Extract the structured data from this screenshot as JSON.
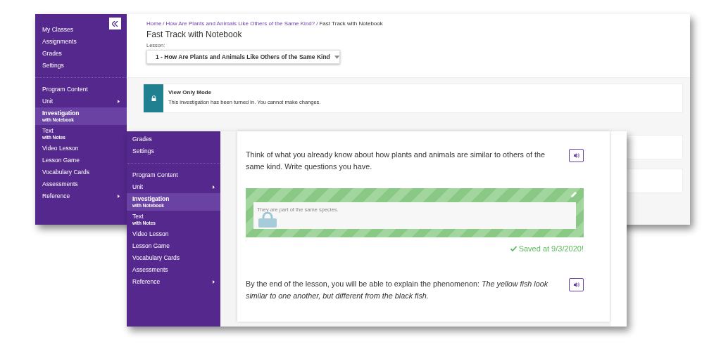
{
  "back_window": {
    "sidebar": {
      "account_items": [
        {
          "label": "My Classes",
          "selected": false,
          "submenu": false
        },
        {
          "label": "Assignments",
          "selected": false,
          "submenu": false
        },
        {
          "label": "Grades",
          "selected": false,
          "submenu": false
        },
        {
          "label": "Settings",
          "selected": false,
          "submenu": false
        }
      ],
      "content_items": [
        {
          "label": "Program Content",
          "selected": false,
          "submenu": false
        },
        {
          "label": "Unit",
          "selected": false,
          "submenu": true
        },
        {
          "label": "Investigation",
          "sublabel": "with Notebook",
          "selected": true,
          "submenu": false
        },
        {
          "label": "Text",
          "sublabel": "with Notes",
          "selected": false,
          "submenu": false
        },
        {
          "label": "Video Lesson",
          "selected": false,
          "submenu": false
        },
        {
          "label": "Lesson Game",
          "selected": false,
          "submenu": false
        },
        {
          "label": "Vocabulary Cards",
          "selected": false,
          "submenu": false
        },
        {
          "label": "Assessments",
          "selected": false,
          "submenu": false
        },
        {
          "label": "Reference",
          "selected": false,
          "submenu": true
        }
      ]
    },
    "breadcrumb": {
      "separator": "/",
      "items": [
        "Home",
        "How Are Plants and Animals Like Others of the Same Kind?",
        "Fast Track with Notebook"
      ]
    },
    "title": "Fast Track with Notebook",
    "lesson_label": "Lesson:",
    "lesson_select": "1 - How Are Plants and Animals Like Others of the Same Kind",
    "notice": {
      "title": "View Only Mode",
      "message": "This investigation has been turned in. You cannot make changes."
    }
  },
  "front_window": {
    "sidebar": {
      "account_items": [
        {
          "label": "Grades",
          "selected": false,
          "submenu": false
        },
        {
          "label": "Settings",
          "selected": false,
          "submenu": false
        }
      ],
      "content_items": [
        {
          "label": "Program Content",
          "selected": false,
          "submenu": false
        },
        {
          "label": "Unit",
          "selected": false,
          "submenu": true
        },
        {
          "label": "Investigation",
          "sublabel": "with Notebook",
          "selected": true,
          "submenu": false
        },
        {
          "label": "Text",
          "sublabel": "with Notes",
          "selected": false,
          "submenu": false
        },
        {
          "label": "Video Lesson",
          "selected": false,
          "submenu": false
        },
        {
          "label": "Lesson Game",
          "selected": false,
          "submenu": false
        },
        {
          "label": "Vocabulary Cards",
          "selected": false,
          "submenu": false
        },
        {
          "label": "Assessments",
          "selected": false,
          "submenu": false
        },
        {
          "label": "Reference",
          "selected": false,
          "submenu": true
        }
      ]
    },
    "prompt": "Think of what you already know about how plants and animals are similar to others of the same kind. Write questions you have.",
    "answer": {
      "value": "They are part of the same species."
    },
    "saved": "Saved at 9/3/2020!",
    "objective": "By the end of the lesson, you will be able to explain the phenomenon: *The yellow fish look similar to one another, but different from the black fish.*"
  }
}
